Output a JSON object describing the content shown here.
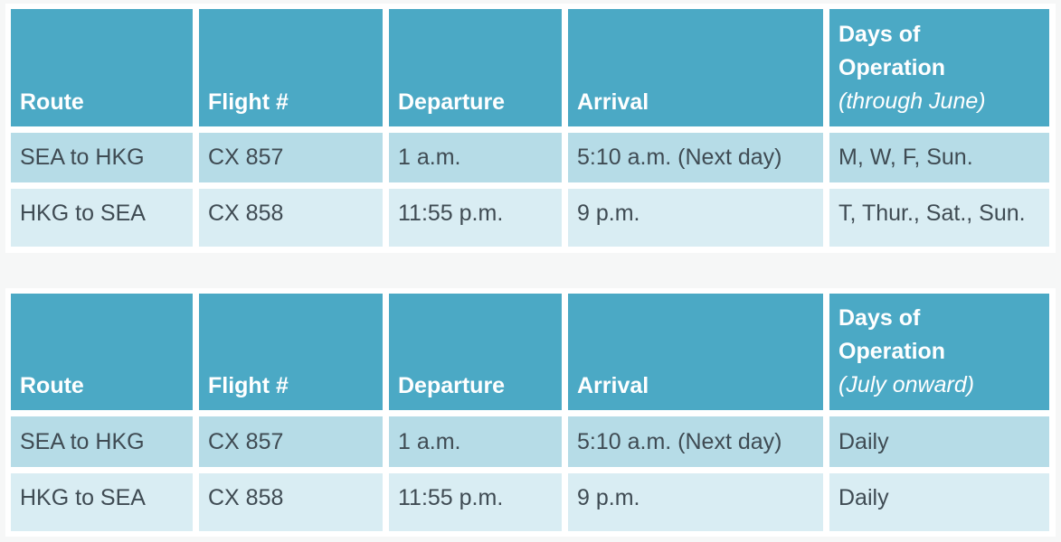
{
  "tables": [
    {
      "headers": [
        "Route",
        "Flight #",
        "Departure",
        "Arrival"
      ],
      "days_header": {
        "title_line1": "Days of",
        "title_line2": "Operation",
        "subtitle": "(through June)"
      },
      "rows": [
        [
          "SEA to HKG",
          "CX 857",
          "1 a.m.",
          "5:10 a.m. (Next day)",
          "M, W, F, Sun."
        ],
        [
          "HKG to SEA",
          "CX 858",
          "11:55 p.m.",
          "9 p.m.",
          "T, Thur., Sat., Sun."
        ]
      ]
    },
    {
      "headers": [
        "Route",
        "Flight #",
        "Departure",
        "Arrival"
      ],
      "days_header": {
        "title_line1": "Days of",
        "title_line2": "Operation",
        "subtitle": "(July onward)"
      },
      "rows": [
        [
          "SEA to HKG",
          "CX 857",
          "1 a.m.",
          "5:10 a.m. (Next day)",
          "Daily"
        ],
        [
          "HKG to SEA",
          "CX 858",
          "11:55 p.m.",
          "9 p.m.",
          "Daily"
        ]
      ]
    }
  ],
  "colors": {
    "header_bg": "#4ba9c5",
    "row_odd_bg": "#b6dce7",
    "row_even_bg": "#d9edf3",
    "text": "#3f4b53",
    "page_bg": "#f6f7f7"
  }
}
